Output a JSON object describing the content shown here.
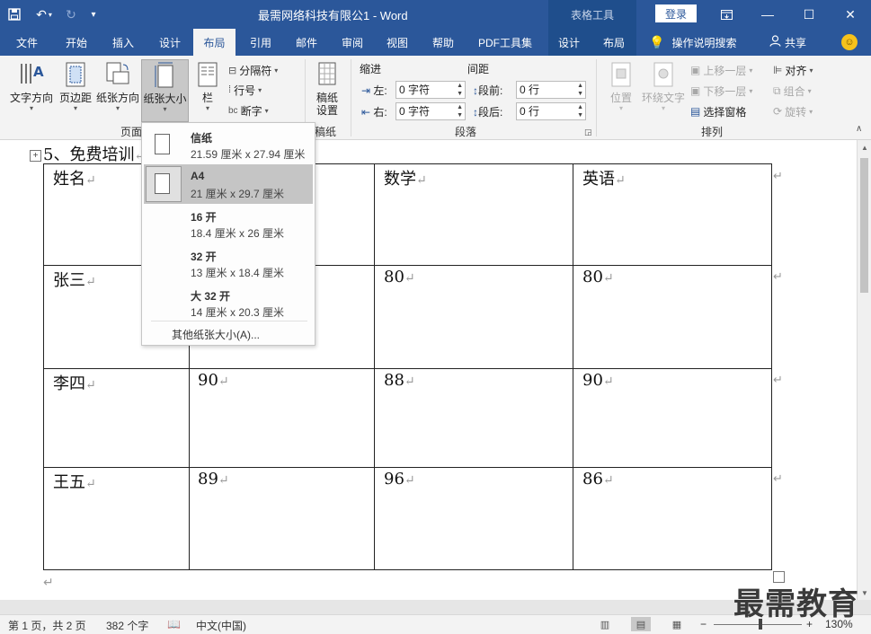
{
  "titlebar": {
    "save_icon": "save-icon",
    "undo_icon": "undo-icon",
    "redo_icon": "redo-icon",
    "doc_title": "最需网络科技有限公1 - Word",
    "context_tab_group": "表格工具",
    "login": "登录"
  },
  "tabs": [
    "文件",
    "开始",
    "插入",
    "设计",
    "布局",
    "引用",
    "邮件",
    "审阅",
    "视图",
    "帮助",
    "PDF工具集",
    "设计",
    "布局"
  ],
  "active_tab": "布局",
  "tellme": "操作说明搜索",
  "share": "共享",
  "ribbon": {
    "page_setup": {
      "text_direction": "文字方向",
      "margins": "页边距",
      "orientation": "纸张方向",
      "size": "纸张大小",
      "columns": "栏",
      "breaks": "分隔符",
      "line_numbers": "行号",
      "hyphenation": "断字",
      "group_label": "页面"
    },
    "manuscript": {
      "button_line1": "稿纸",
      "button_line2": "设置",
      "group_label": "稿纸"
    },
    "paragraph": {
      "indent_title": "缩进",
      "spacing_title": "间距",
      "left_label": "左:",
      "left_value": "0 字符",
      "right_label": "右:",
      "right_value": "0 字符",
      "before_label": "段前:",
      "before_value": "0 行",
      "after_label": "段后:",
      "after_value": "0 行",
      "group_label": "段落"
    },
    "arrange": {
      "position": "位置",
      "wrap_text": "环绕文字",
      "bring_forward": "上移一层",
      "send_backward": "下移一层",
      "selection_pane": "选择窗格",
      "align": "对齐",
      "group": "组合",
      "rotate": "旋转",
      "group_label": "排列"
    }
  },
  "paper_sizes": [
    {
      "name": "信纸",
      "dims": "21.59 厘米 x 27.94 厘米",
      "selected": false
    },
    {
      "name": "A4",
      "dims": "21 厘米 x 29.7 厘米",
      "selected": true
    },
    {
      "name": "16 开",
      "dims": "18.4 厘米 x 26 厘米",
      "selected": false
    },
    {
      "name": "32 开",
      "dims": "13 厘米 x 18.4 厘米",
      "selected": false
    },
    {
      "name": "大 32 开",
      "dims": "14 厘米 x 20.3 厘米",
      "selected": false
    }
  ],
  "more_paper_sizes": "其他纸张大小(A)...",
  "document": {
    "heading": "5、免费培训",
    "para_mark": "↵",
    "table": [
      [
        "姓名",
        "",
        "数学",
        "英语"
      ],
      [
        "张三",
        "",
        "80",
        "80"
      ],
      [
        "李四",
        "90",
        "88",
        "90"
      ],
      [
        "王五",
        "89",
        "96",
        "86"
      ]
    ]
  },
  "statusbar": {
    "page": "第 1 页，共 2 页",
    "words": "382 个字",
    "language": "中文(中国)",
    "zoom_minus": "−",
    "zoom_plus": "+",
    "zoom": "130%"
  },
  "watermark": "最需教育"
}
